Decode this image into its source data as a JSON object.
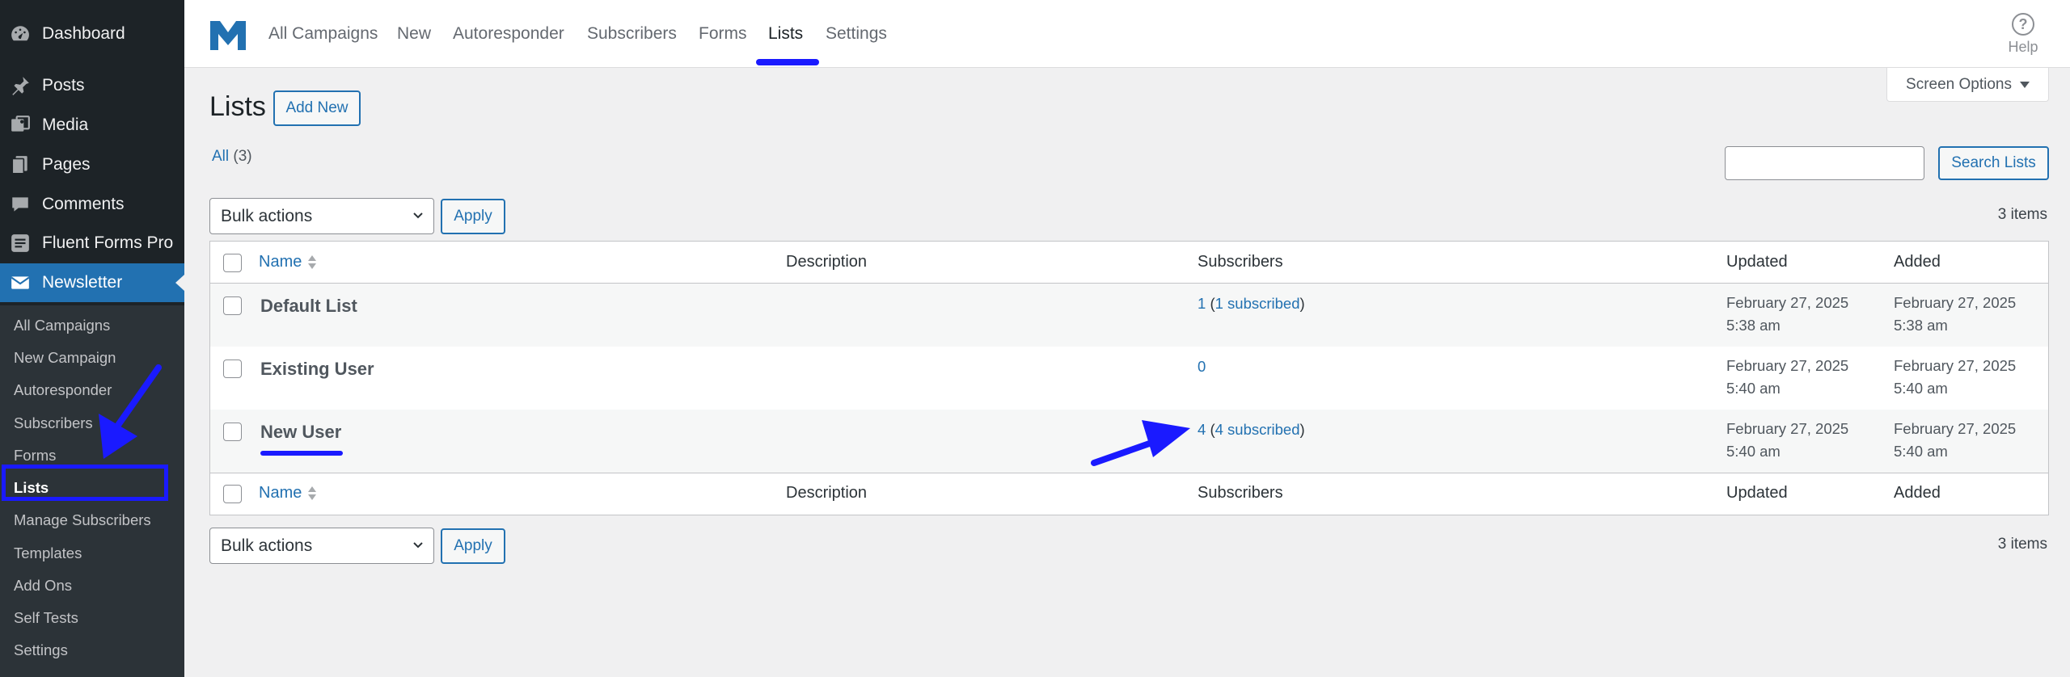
{
  "sidebar": {
    "menu": [
      {
        "label": "Dashboard",
        "icon": "dashboard-icon"
      },
      {
        "label": "Posts",
        "icon": "pin-icon"
      },
      {
        "label": "Media",
        "icon": "media-icon"
      },
      {
        "label": "Pages",
        "icon": "pages-icon"
      },
      {
        "label": "Comments",
        "icon": "comment-icon"
      },
      {
        "label": "Fluent Forms Pro",
        "icon": "forms-icon"
      },
      {
        "label": "Newsletter",
        "icon": "envelope-icon"
      }
    ],
    "submenu": [
      "All Campaigns",
      "New Campaign",
      "Autoresponder",
      "Subscribers",
      "Forms",
      "Lists",
      "Manage Subscribers",
      "Templates",
      "Add Ons",
      "Self Tests",
      "Settings"
    ]
  },
  "topnav": {
    "links": [
      "All Campaigns",
      "New",
      "Autoresponder",
      "Subscribers",
      "Forms",
      "Lists",
      "Settings"
    ],
    "help_label": "Help"
  },
  "screen_options_label": "Screen Options",
  "page": {
    "title": "Lists",
    "add_new_label": "Add New",
    "filter_all_label": "All",
    "filter_all_count": "(3)",
    "search_button_label": "Search Lists",
    "bulk_actions_label": "Bulk actions",
    "apply_label": "Apply",
    "items_count": "3 items"
  },
  "table": {
    "columns": {
      "name": "Name",
      "description": "Description",
      "subscribers": "Subscribers",
      "updated": "Updated",
      "added": "Added"
    },
    "rows": [
      {
        "name": "Default List",
        "subs_count": "1",
        "subs_detail": "1 subscribed",
        "updated_date": "February 27, 2025",
        "updated_time": "5:38 am",
        "added_date": "February 27, 2025",
        "added_time": "5:38 am"
      },
      {
        "name": "Existing User",
        "subs_count": "0",
        "subs_detail": "",
        "updated_date": "February 27, 2025",
        "updated_time": "5:40 am",
        "added_date": "February 27, 2025",
        "added_time": "5:40 am"
      },
      {
        "name": "New User",
        "subs_count": "4",
        "subs_detail": "4 subscribed",
        "updated_date": "February 27, 2025",
        "updated_time": "5:40 am",
        "added_date": "February 27, 2025",
        "added_time": "5:40 am"
      }
    ]
  },
  "colors": {
    "sidebar_bg": "#1d2327",
    "accent": "#2271b1",
    "annotation": "#1a1aff"
  }
}
